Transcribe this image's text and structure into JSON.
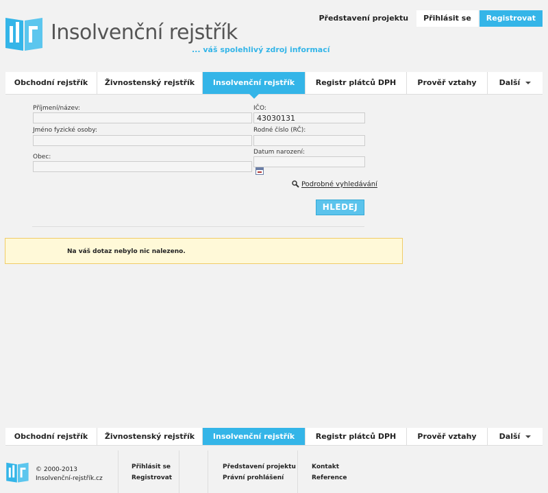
{
  "header": {
    "logo_title": "Insolvenční rejstřík",
    "logo_tagline": "... váš spolehlivý zdroj informací",
    "top_links": {
      "project": "Představení projektu",
      "login": "Přihlásit se",
      "register": "Registrovat"
    }
  },
  "nav": {
    "tabs": [
      "Obchodní rejstřík",
      "Živnostenský rejstřík",
      "Insolvenční rejstřík",
      "Registr plátců DPH",
      "Prověř vztahy",
      "Další"
    ],
    "active_index": 2
  },
  "form": {
    "surname_label": "Příjmení/název:",
    "surname_value": "",
    "firstname_label": "Jméno fyzické osoby:",
    "firstname_value": "",
    "city_label": "Obec:",
    "city_value": "",
    "ico_label": "IČO:",
    "ico_value": "43030131",
    "birth_number_label": "Rodné číslo (RČ):",
    "birth_number_value": "",
    "birth_date_label": "Datum narození:",
    "birth_date_value": "",
    "advanced_search": "Podrobné vyhledávání",
    "search_button": "HLEDEJ"
  },
  "result": {
    "message": "Na váš dotaz nebylo nic nalezeno."
  },
  "footer": {
    "copyright": "© 2000-2013",
    "site": "Insolvenční-rejstřík.cz",
    "col1": [
      "Přihlásit se",
      "Registrovat"
    ],
    "col2": [
      "Představení projektu",
      "Právní prohlášení"
    ],
    "col3": [
      "Kontakt",
      "Reference"
    ]
  },
  "colors": {
    "accent": "#34b5e8",
    "alert_bg": "#fff9d8",
    "alert_border": "#f0cc66"
  }
}
